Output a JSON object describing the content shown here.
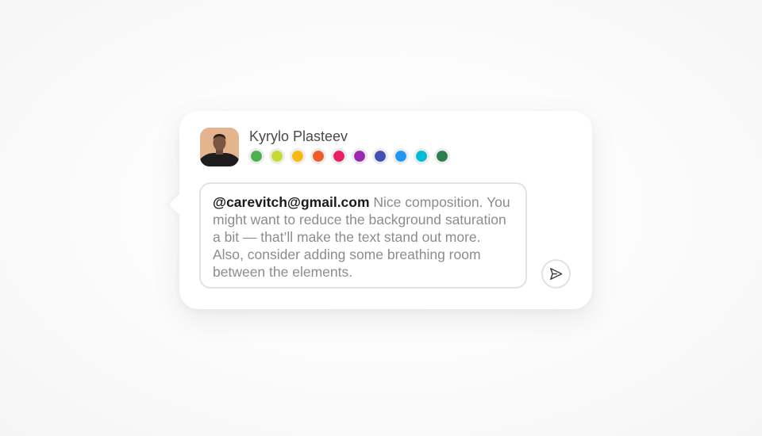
{
  "user": {
    "name": "Kyrylo Plasteev",
    "avatar": "user-photo"
  },
  "colors": [
    {
      "name": "green",
      "hex": "#4caf50"
    },
    {
      "name": "lime",
      "hex": "#c6d930"
    },
    {
      "name": "yellow",
      "hex": "#f6b90f"
    },
    {
      "name": "orange",
      "hex": "#f15a29"
    },
    {
      "name": "pink",
      "hex": "#e91e63"
    },
    {
      "name": "purple",
      "hex": "#9c27b0"
    },
    {
      "name": "indigo",
      "hex": "#3f51b5"
    },
    {
      "name": "blue",
      "hex": "#2196f3"
    },
    {
      "name": "cyan",
      "hex": "#00bcd4"
    },
    {
      "name": "dark-green",
      "hex": "#2e7d4f"
    }
  ],
  "comment": {
    "mention": "@carevitch@gmail.com",
    "text": " Nice composition. You might want to reduce the background saturation a bit — that’ll make the text stand out more. Also, consider adding some breathing room between the elements."
  },
  "send_button": {
    "icon": "send-icon"
  }
}
